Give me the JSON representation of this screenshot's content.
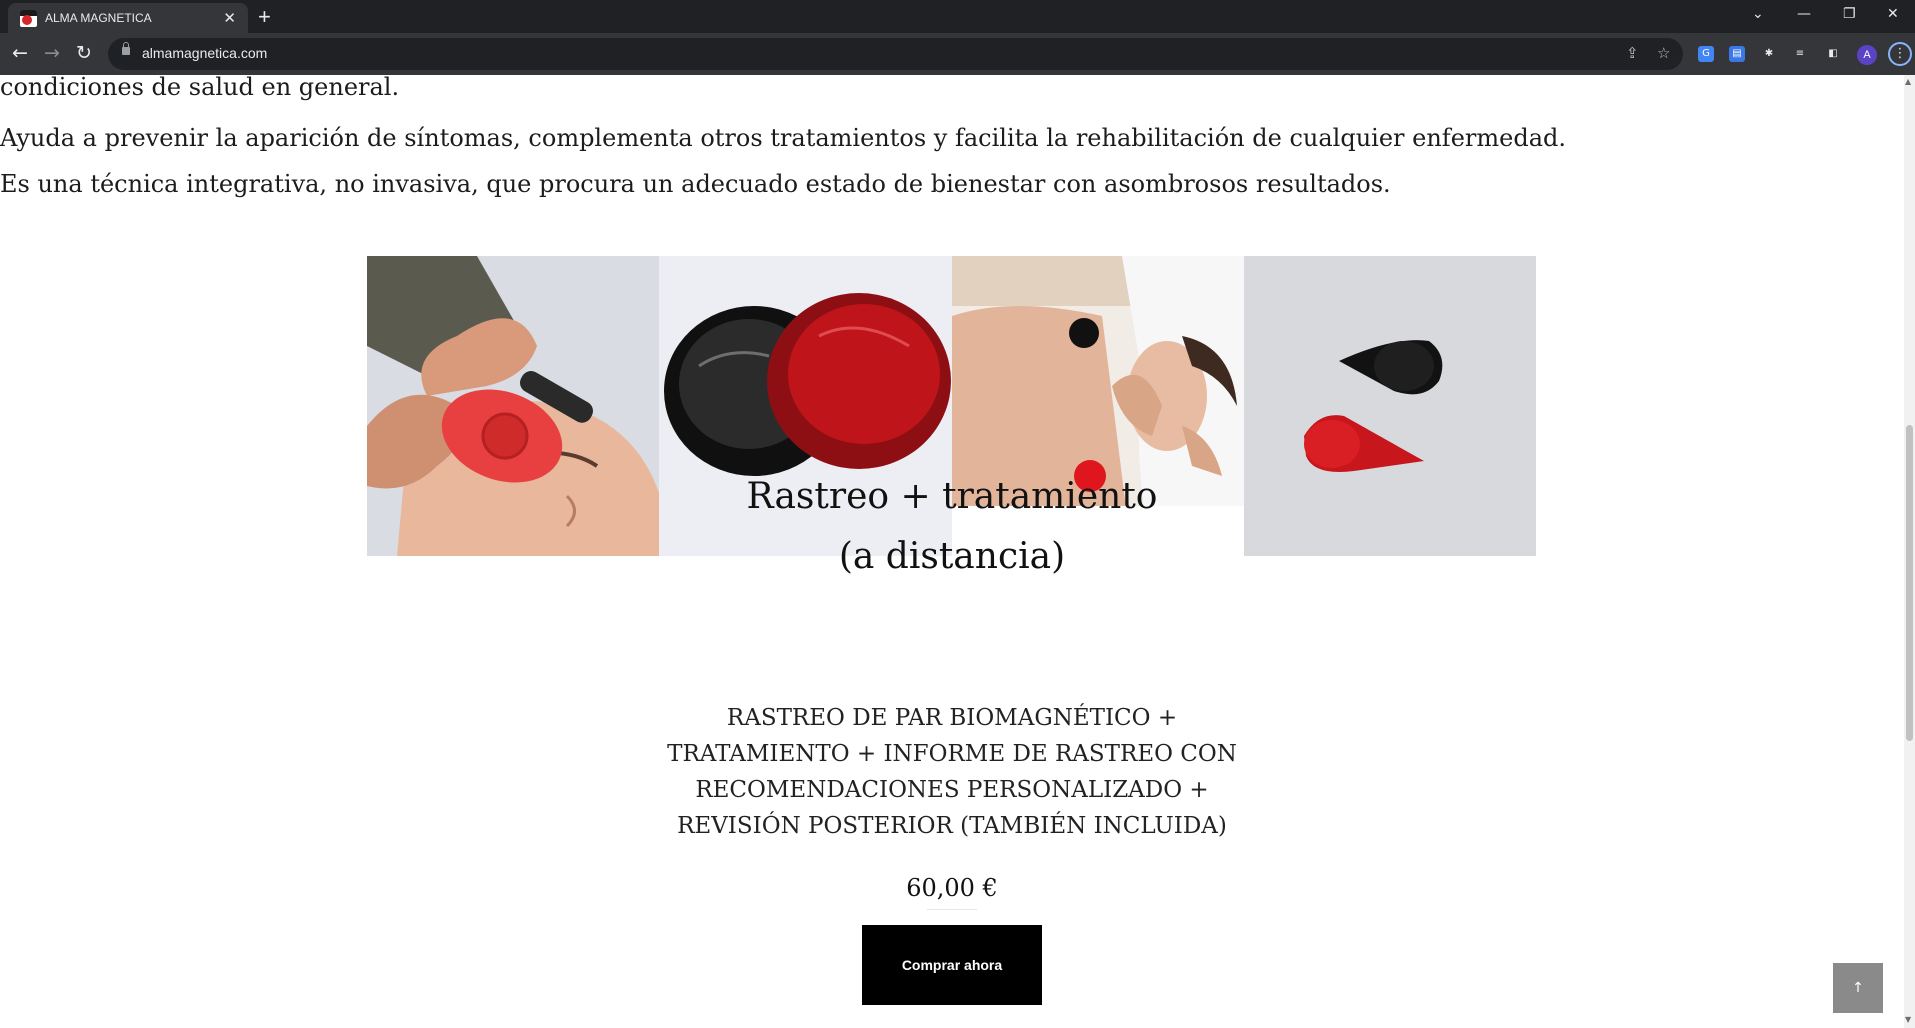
{
  "browser": {
    "tab_title": "ALMA MAGNETICA",
    "tab_close": "✕",
    "new_tab": "+",
    "url": "almamagnetica.com",
    "avatar_letter": "A",
    "controls": {
      "chevron": "⌄",
      "minimize": "—",
      "restore": "❐",
      "close": "✕"
    },
    "nav": {
      "back": "←",
      "forward": "→",
      "reload": "↻"
    },
    "omnibox_icons": {
      "share": "⇪",
      "bookmark": "☆"
    },
    "extensions": [
      {
        "icon": "translate-icon",
        "glyph": "G",
        "color": "#4285f4"
      },
      {
        "icon": "document-icon",
        "glyph": "▤",
        "color": "#4a7fe0"
      },
      {
        "icon": "puzzle-icon",
        "glyph": "✱",
        "color": "#5f6368"
      },
      {
        "icon": "reading-list-icon",
        "glyph": "≡",
        "color": "#5f6368"
      },
      {
        "icon": "side-panel-icon",
        "glyph": "◧",
        "color": "#5f6368"
      }
    ],
    "menu_glyph": "⋮"
  },
  "page": {
    "partial_line": "condiciones de salud en general.",
    "para1": "Ayuda a prevenir la aparición de síntomas, complementa otros tratamientos y facilita la rehabilitación de cualquier enfermedad.",
    "para2": "Es una técnica integrativa, no invasiva, que procura un adecuado estado de bienestar con asombrosos resultados.",
    "product": {
      "title_line1": "Rastreo + tratamiento",
      "title_line2": "(a distancia)",
      "description_lines": [
        "RASTREO DE PAR BIOMAGNÉTICO +",
        "TRATAMIENTO + INFORME DE RASTREO CON",
        "RECOMENDACIONES PERSONALIZADO +",
        "REVISIÓN POSTERIOR (TAMBIÉN INCLUIDA)"
      ],
      "price": "60,00 €",
      "buy_label": "Comprar ahora"
    },
    "back_to_top": "↑"
  },
  "colors": {
    "magnet_red": "#c8161d",
    "magnet_black": "#141414",
    "button_bg": "#000000",
    "back_to_top_bg": "#8a8a8a"
  }
}
